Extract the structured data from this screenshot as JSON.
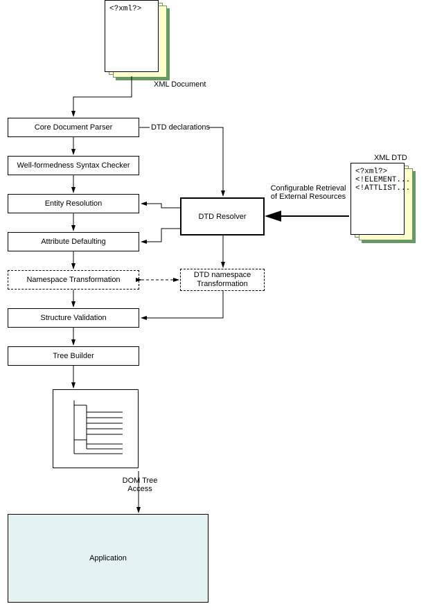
{
  "xmlDoc": {
    "headerText": "<?xml?>",
    "caption": "XML Document"
  },
  "xmlDtd": {
    "caption": "XML DTD",
    "line1": "<?xml?>",
    "line2": "<!ELEMENT...",
    "line3": "<!ATTLIST..."
  },
  "boxes": {
    "coreParser": "Core Document Parser",
    "wellFormed": "Well-formedness Syntax Checker",
    "entityRes": "Entity Resolution",
    "attrDefault": "Attribute Defaulting",
    "nsTransform": "Namespace Transformation",
    "dtdNsTransform": "DTD namespace Transformation",
    "structValidation": "Structure Validation",
    "treeBuilder": "Tree Builder",
    "dtdResolver": "DTD Resolver",
    "application": "Application"
  },
  "edgeLabels": {
    "dtdDecl": "DTD declarations",
    "configRetrieval": "Configurable Retrieval of External Resources",
    "domTree": "DOM Tree Access"
  }
}
